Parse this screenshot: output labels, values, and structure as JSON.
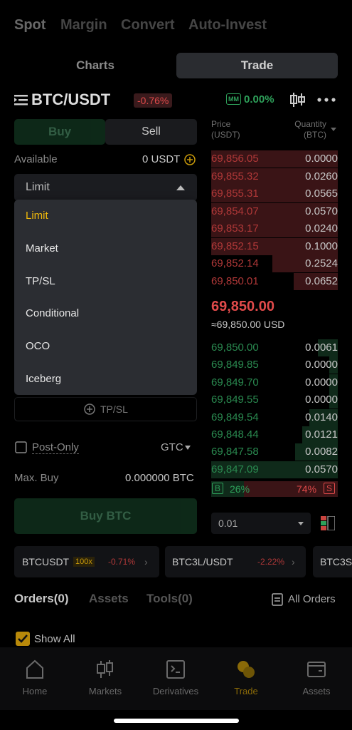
{
  "top_tabs": [
    "Spot",
    "Margin",
    "Convert",
    "Auto-Invest"
  ],
  "view_toggle": {
    "charts": "Charts",
    "trade": "Trade"
  },
  "pair": {
    "symbol": "BTC/USDT",
    "change": "-0.76%",
    "mm_badge": "MM",
    "mm_value": "0.00%"
  },
  "form": {
    "buy": "Buy",
    "sell": "Sell",
    "available_label": "Available",
    "available_value": "0 USDT",
    "order_type": "Limit",
    "dropdown_options": [
      "Limit",
      "Market",
      "TP/SL",
      "Conditional",
      "OCO",
      "Iceberg"
    ],
    "tpsl": "TP/SL",
    "post_only": "Post-Only",
    "tif": "GTC",
    "max_buy_label": "Max. Buy",
    "max_buy_value": "0.000000 BTC",
    "buy_cta": "Buy BTC"
  },
  "orderbook": {
    "price_header": "Price\n(USDT)",
    "qty_header": "Quantity\n(BTC)",
    "asks": [
      {
        "price": "69,856.05",
        "qty": "0.0000"
      },
      {
        "price": "69,855.32",
        "qty": "0.0260"
      },
      {
        "price": "69,855.31",
        "qty": "0.0565"
      },
      {
        "price": "69,854.07",
        "qty": "0.0570"
      },
      {
        "price": "69,853.17",
        "qty": "0.0240"
      },
      {
        "price": "69,852.15",
        "qty": "0.1000"
      },
      {
        "price": "69,852.14",
        "qty": "0.2524"
      },
      {
        "price": "69,850.01",
        "qty": "0.0652"
      }
    ],
    "mid_price": "69,850.00",
    "mid_usd": "≈69,850.00 USD",
    "bids": [
      {
        "price": "69,850.00",
        "qty": "0.0061"
      },
      {
        "price": "69,849.85",
        "qty": "0.0000"
      },
      {
        "price": "69,849.70",
        "qty": "0.0000"
      },
      {
        "price": "69,849.55",
        "qty": "0.0000"
      },
      {
        "price": "69,849.54",
        "qty": "0.0140"
      },
      {
        "price": "69,848.44",
        "qty": "0.0121"
      },
      {
        "price": "69,847.58",
        "qty": "0.0082"
      },
      {
        "price": "69,847.09",
        "qty": "0.0570"
      }
    ],
    "buy_badge": "B",
    "buy_pct": "26%",
    "sell_pct": "74%",
    "sell_badge": "S",
    "buy_ratio": 0.26,
    "precision": "0.01"
  },
  "tickers": [
    {
      "name": "BTCUSDT",
      "lev": "100x",
      "chg": "-0.71%"
    },
    {
      "name": "BTC3L/USDT",
      "chg": "-2.22%"
    },
    {
      "name": "BTC3S"
    }
  ],
  "bottom_tabs": {
    "orders": "Orders(0)",
    "assets": "Assets",
    "tools": "Tools(0)",
    "all_orders": "All Orders",
    "show_all": "Show All"
  },
  "nav": [
    "Home",
    "Markets",
    "Derivatives",
    "Trade",
    "Assets"
  ],
  "colors": {
    "green": "#2ea05a",
    "red": "#e04a4a",
    "accent": "#f0b90b"
  }
}
